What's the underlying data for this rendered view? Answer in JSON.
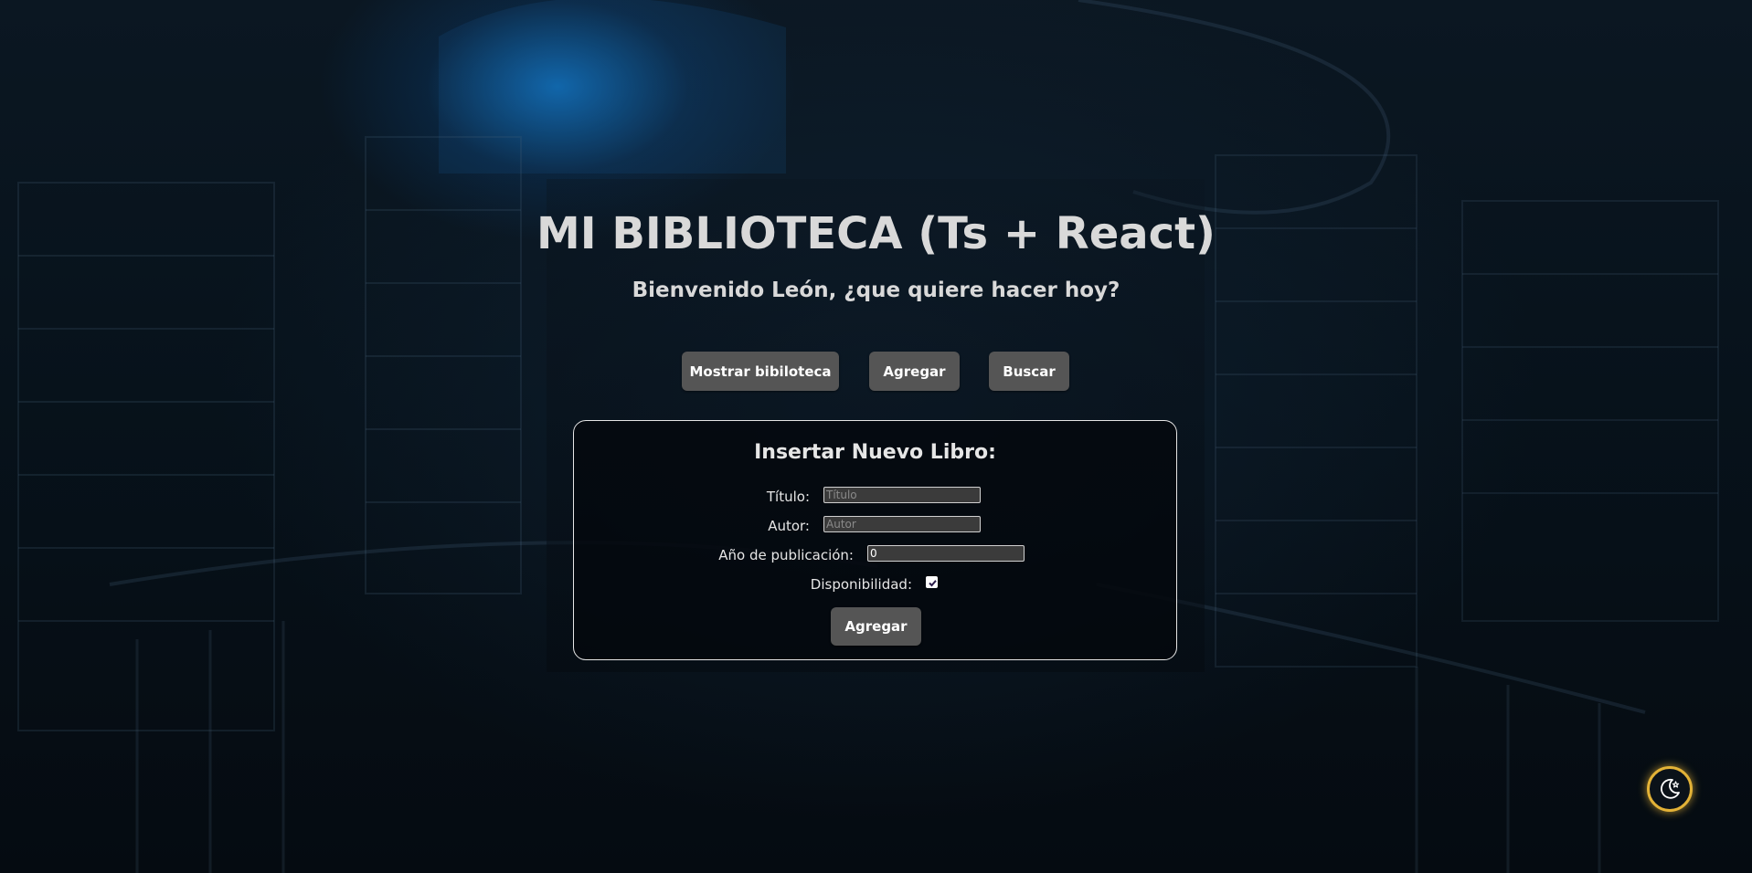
{
  "header": {
    "title": "MI BIBLIOTECA (Ts + React)",
    "subtitle": "Bienvenido León, ¿que quiere hacer hoy?"
  },
  "nav": {
    "show_library": "Mostrar bibiloteca",
    "add": "Agregar",
    "search": "Buscar"
  },
  "form": {
    "title": "Insertar Nuevo Libro:",
    "titulo_label": "Título:",
    "titulo_placeholder": "Título",
    "titulo_value": "",
    "autor_label": "Autor:",
    "autor_placeholder": "Autor",
    "autor_value": "",
    "anio_label": "Año de publicación:",
    "anio_value": "0",
    "disponibilidad_label": "Disponibilidad:",
    "disponibilidad_checked": true,
    "submit_label": "Agregar"
  },
  "theme_toggle": {
    "icon": "moon-star-icon",
    "accent_color": "#e3b237"
  },
  "colors": {
    "button_bg": "#555555",
    "text": "#d9d9d9",
    "card_border": "#e6e6e6"
  }
}
